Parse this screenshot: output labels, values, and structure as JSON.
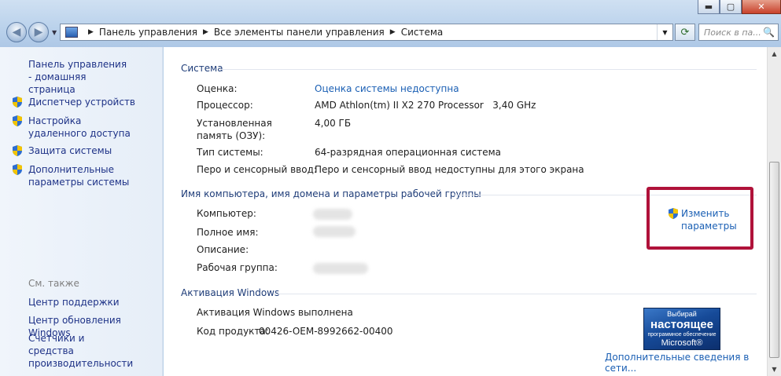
{
  "window": {
    "minimize_glyph": "▬",
    "maximize_glyph": "▢",
    "close_glyph": "✕"
  },
  "nav": {
    "back_glyph": "◀",
    "forward_glyph": "▶",
    "dropdown_glyph": "▼"
  },
  "address": {
    "crumbs": [
      "Панель управления",
      "Все элементы панели управления",
      "Система"
    ],
    "separator": "▶",
    "dropdown_glyph": "▼"
  },
  "refresh_glyph": "⟳",
  "search": {
    "placeholder": "Поиск в па...",
    "icon_glyph": "🔍"
  },
  "sidebar": {
    "home_link": "Панель управления - домашняя страница",
    "items": [
      {
        "label": "Диспетчер устройств",
        "icon": "shield-icon"
      },
      {
        "label": "Настройка удаленного доступа",
        "icon": "shield-icon"
      },
      {
        "label": "Защита системы",
        "icon": "shield-icon"
      },
      {
        "label": "Дополнительные параметры системы",
        "icon": "shield-icon"
      }
    ],
    "see_also": "См. также",
    "see_also_links": [
      "Центр поддержки",
      "Центр обновления Windows",
      "Счетчики и средства производительности"
    ]
  },
  "system": {
    "title": "Система",
    "rating_label": "Оценка:",
    "rating_value": "Оценка системы недоступна",
    "cpu_label": "Процессор:",
    "cpu_value": "AMD Athlon(tm) II X2 270 Processor   3,40 GHz",
    "ram_label": "Установленная память (ОЗУ):",
    "ram_value": "4,00 ГБ",
    "type_label": "Тип системы:",
    "type_value": "64-разрядная операционная система",
    "pen_label": "Перо и сенсорный ввод:",
    "pen_value": "Перо и сенсорный ввод недоступны для этого экрана"
  },
  "computer": {
    "title": "Имя компьютера, имя домена и параметры рабочей группы",
    "name_label": "Компьютер:",
    "fullname_label": "Полное имя:",
    "desc_label": "Описание:",
    "workgroup_label": "Рабочая группа:",
    "change_link": "Изменить параметры"
  },
  "activation": {
    "title": "Активация Windows",
    "status": "Активация Windows выполнена",
    "product_key_label": "Код продукта:",
    "product_key": "00426-OEM-8992662-00400",
    "badge_line1": "Выбирай",
    "badge_line2": "настоящее",
    "badge_line3": "программное обеспечение",
    "badge_line4": "Microsoft®",
    "more_link": "Дополнительные сведения в сети..."
  },
  "colors": {
    "link": "#1a5fb4",
    "highlight": "#b0123a",
    "sidebar_link": "#1e3287"
  }
}
